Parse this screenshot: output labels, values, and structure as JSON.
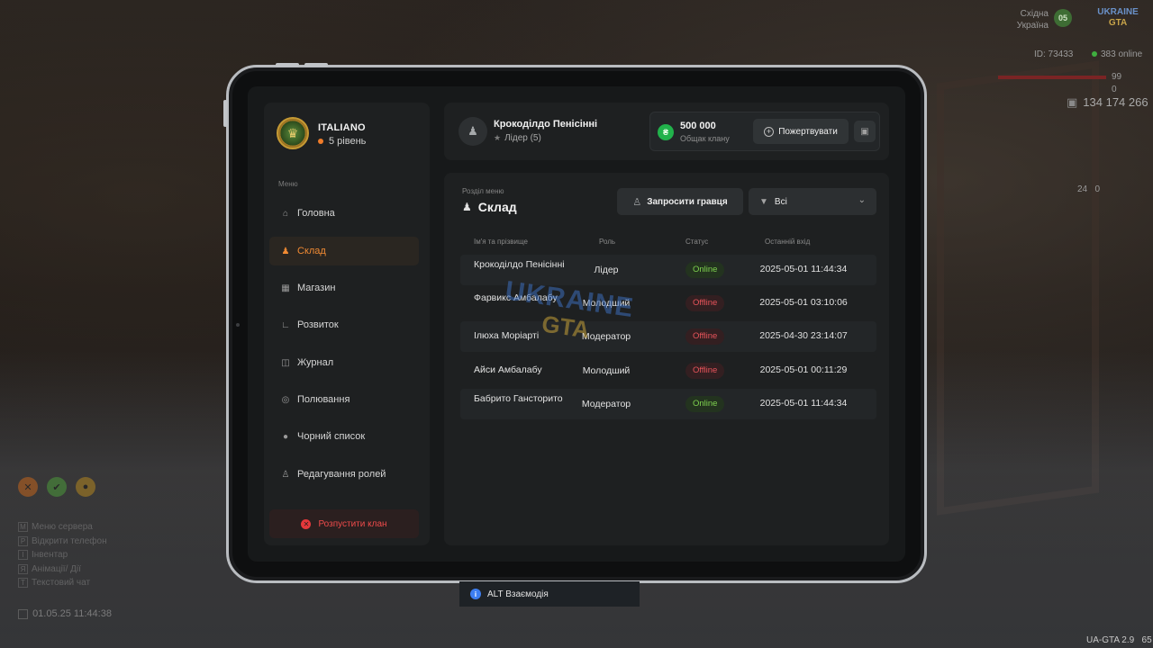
{
  "hud": {
    "region_line1": "Східна",
    "region_line2": "Україна",
    "region_badge": "05",
    "logo_line1": "UKRAINE",
    "logo_line2": "GTA",
    "player_id": "ID: 73433",
    "online": "383 online",
    "health": "99",
    "armor": "0",
    "money": "134 174 266",
    "ammo": "24",
    "ammo_extra": "0",
    "version": "UA-GTA 2.9",
    "fps": "65",
    "datetime": "01.05.25 11:44:38",
    "keys": [
      {
        "key": "M",
        "label": "Меню сервера"
      },
      {
        "key": "P",
        "label": "Відкрити телефон"
      },
      {
        "key": "I",
        "label": "Інвентар"
      },
      {
        "key": "Я",
        "label": "Анімації/ Дії"
      },
      {
        "key": "T",
        "label": "Текстовий чат"
      }
    ]
  },
  "sidebar": {
    "clan_name": "ITALIANO",
    "clan_level": "5 рівень",
    "menu_caption": "Меню",
    "items": [
      {
        "label": "Головна",
        "icon": "home-icon"
      },
      {
        "label": "Склад",
        "icon": "members-icon",
        "active": true
      },
      {
        "label": "Магазин",
        "icon": "shop-icon"
      },
      {
        "label": "Розвиток",
        "icon": "chart-icon"
      },
      {
        "label": "Журнал",
        "icon": "book-icon"
      },
      {
        "label": "Полювання",
        "icon": "target-icon"
      },
      {
        "label": "Чорний список",
        "icon": "block-icon"
      },
      {
        "label": "Редагування ролей",
        "icon": "user-edit-icon"
      }
    ],
    "disband_label": "Розпустити клан"
  },
  "header": {
    "user_name": "Крокоділдо Пенісінні",
    "user_role": "Лідер (5)",
    "money_value": "500 000",
    "money_label": "Общак клану",
    "donate_label": "Пожертвувати"
  },
  "main": {
    "section_caption": "Розділ меню",
    "section_title": "Склад",
    "invite_label": "Запросити гравця",
    "filter_value": "Всі",
    "columns": [
      "Ім'я та прізвище",
      "Роль",
      "Статус",
      "Останній вхід"
    ],
    "rows": [
      {
        "name": "Крокоділдо Пенісінні",
        "role": "Лідер",
        "status": "Online",
        "last": "2025-05-01 11:44:34"
      },
      {
        "name": "Фарвикс Амбалабу",
        "role": "Молодший",
        "status": "Offline",
        "last": "2025-05-01 03:10:06"
      },
      {
        "name": "Ілюха Моріарті",
        "role": "Модератор",
        "status": "Offline",
        "last": "2025-04-30 23:14:07"
      },
      {
        "name": "Айси Амбалабу",
        "role": "Молодший",
        "status": "Offline",
        "last": "2025-05-01 00:11:29"
      },
      {
        "name": "Бабрито Гансторито",
        "role": "Модератор",
        "status": "Online",
        "last": "2025-05-01 11:44:34"
      }
    ],
    "watermark_line1": "UKRAINE",
    "watermark_line2": "GTA"
  },
  "hint": {
    "label": "ALT Взаємодія"
  },
  "colors": {
    "accent": "#f08a33",
    "online": "#7ed24f",
    "offline": "#e8545b",
    "money": "#21b24b",
    "danger": "#e5383b"
  }
}
